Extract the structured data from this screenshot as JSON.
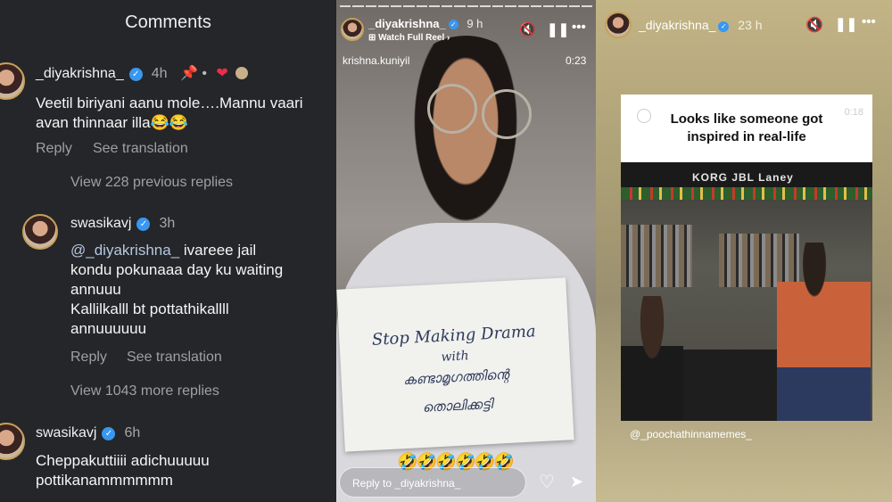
{
  "comments_panel": {
    "title": "Comments",
    "comment1": {
      "username": "_diyakrishna_",
      "time": "4h",
      "extras": "📌 • ❤",
      "text": "Veetil biriyani aanu mole….Mannu vaari avan thinnaar illa😂😂",
      "reply": "Reply",
      "translate": "See translation"
    },
    "view_previous": "View 228 previous replies",
    "comment2": {
      "username": "swasikavj",
      "time": "3h",
      "mention": "@_diyakrishna_",
      "text_line1": " ivareee jail",
      "text_line2": "kondu pokunaaa day ku waiting",
      "text_line3": "annuuu",
      "text_line4": "Kallilkalll bt pottathikallll",
      "text_line5": "annuuuuuu",
      "reply": "Reply",
      "translate": "See translation"
    },
    "view_more": "View 1043 more replies",
    "comment3": {
      "username": "swasikavj",
      "time": "6h",
      "text_line1": "Cheppakuttiiii adichuuuuu",
      "text_line2": "pottikanammmmmm"
    }
  },
  "story1": {
    "username": "_diyakrishna_",
    "time": "9 h",
    "watch_full_reel": "Watch Full Reel",
    "source": "krishna.kuniyil",
    "timer": "0:23",
    "sign_line1": "Stop Making Drama",
    "sign_line2": "with",
    "sign_line3": "കണ്ടാമൃഗത്തിന്റെ",
    "sign_line4": "തൊലിക്കട്ടി",
    "emojis": "🤣🤣🤣🤣🤣🤣",
    "reply_placeholder": "Reply to _diyakrishna_"
  },
  "story2": {
    "username": "_diyakrishna_",
    "time": "23 h",
    "card_title_line1": "Looks like someone got",
    "card_title_line2": "inspired in real-life",
    "card_timer": "0:18",
    "brand_text": "KORG  JBL  Laney",
    "handle": "@_poochathinnamemes_"
  },
  "colors": {
    "verified": "#3897f0",
    "heart": "#ed2d4a",
    "panel_dark": "#242629"
  }
}
